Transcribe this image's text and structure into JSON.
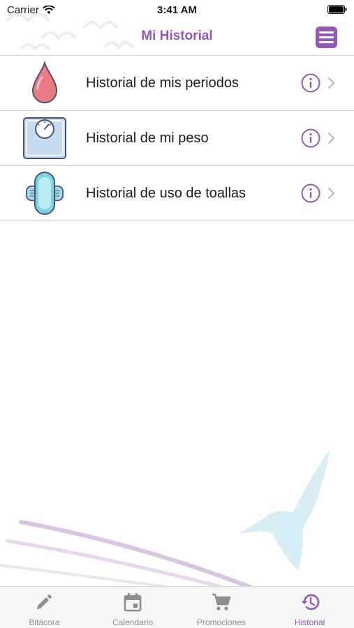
{
  "status_bar": {
    "carrier": "Carrier",
    "time": "3:41 AM"
  },
  "nav": {
    "title": "Mi Historial",
    "menu_icon": "menu-icon"
  },
  "items": [
    {
      "label": "Historial de mis periodos",
      "icon": "blood-drop-icon"
    },
    {
      "label": "Historial de mi peso",
      "icon": "weight-scale-icon"
    },
    {
      "label": "Historial de uso de toallas",
      "icon": "sanitary-pad-icon"
    }
  ],
  "tabs": [
    {
      "label": "Bitácora",
      "icon": "pencil-icon",
      "active": false
    },
    {
      "label": "Calendario",
      "icon": "calendar-icon",
      "active": false
    },
    {
      "label": "Promociones",
      "icon": "cart-icon",
      "active": false
    },
    {
      "label": "Historial",
      "icon": "history-icon",
      "active": true
    }
  ],
  "colors": {
    "accent": "#9358b3",
    "tab_inactive": "#8e8e8e",
    "drop": "#e66b78",
    "scale_fill": "#c6dcf2",
    "pad_fill": "#7fd2e1"
  }
}
